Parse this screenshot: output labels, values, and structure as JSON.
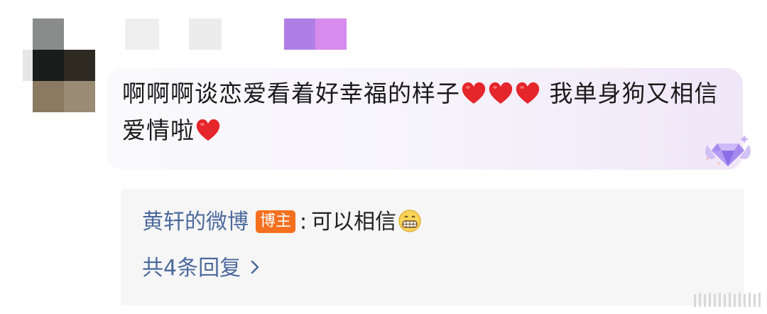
{
  "comment": {
    "text_part1": "啊啊啊谈恋爱看着好幸福的样子",
    "text_part2": " 我单身狗又相信爱情啦",
    "heart_emoji": "heart-emoji",
    "badge_icon": "purple-gem-badge-icon"
  },
  "reply": {
    "author": "黄轩的微博",
    "author_badge": "博主",
    "separator": ":",
    "text": "可以相信",
    "emoji": "grin-emoji",
    "total_replies": "共4条回复",
    "chevron_icon": "chevron-right-icon"
  },
  "colors": {
    "link_blue": "#4c6a9c",
    "badge_orange": "#f46f1e",
    "heart_red": "#e5262a",
    "bubble_purple": "#efe6f8"
  }
}
